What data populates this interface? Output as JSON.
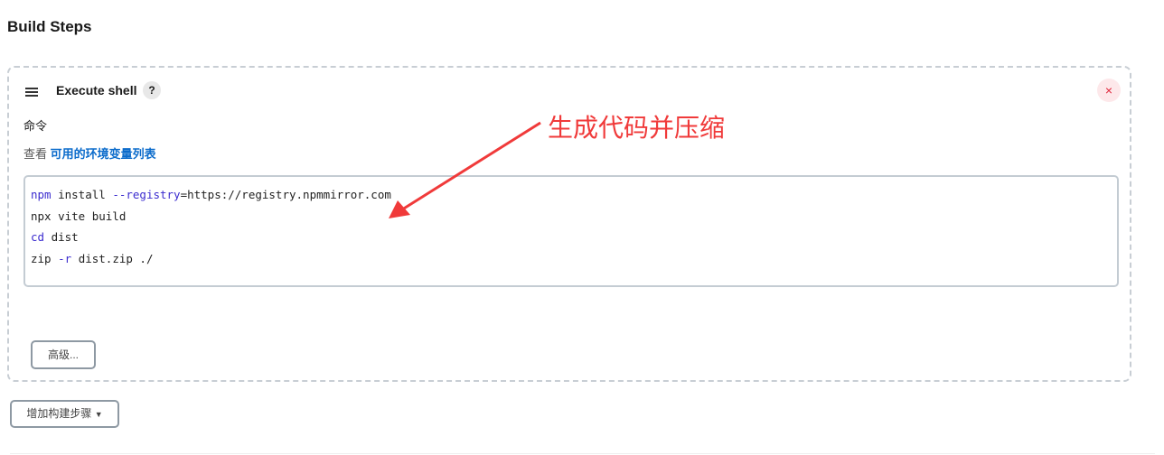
{
  "page": {
    "title": "Build Steps"
  },
  "step": {
    "title": "Execute shell",
    "help": "?",
    "close": "×",
    "command_label": "命令",
    "env_prefix": "查看",
    "env_link": "可用的环境变量列表",
    "code_lines": [
      [
        {
          "t": "npm",
          "k": 1
        },
        {
          "t": " install ",
          "k": 0
        },
        {
          "t": "--registry",
          "k": 1
        },
        {
          "t": "=https://registry.npmmirror.com",
          "k": 0
        }
      ],
      [
        {
          "t": "npx vite build",
          "k": 0
        }
      ],
      [
        {
          "t": "cd",
          "k": 1
        },
        {
          "t": " dist",
          "k": 0
        }
      ],
      [
        {
          "t": "zip ",
          "k": 0
        },
        {
          "t": "-r",
          "k": 1
        },
        {
          "t": " dist.zip ./",
          "k": 0
        }
      ]
    ],
    "advanced": "高级..."
  },
  "add_step": {
    "label": "增加构建步骤",
    "icon": "caret-down-icon"
  },
  "annotation": {
    "text": "生成代码并压缩",
    "color": "#f03a3a"
  }
}
